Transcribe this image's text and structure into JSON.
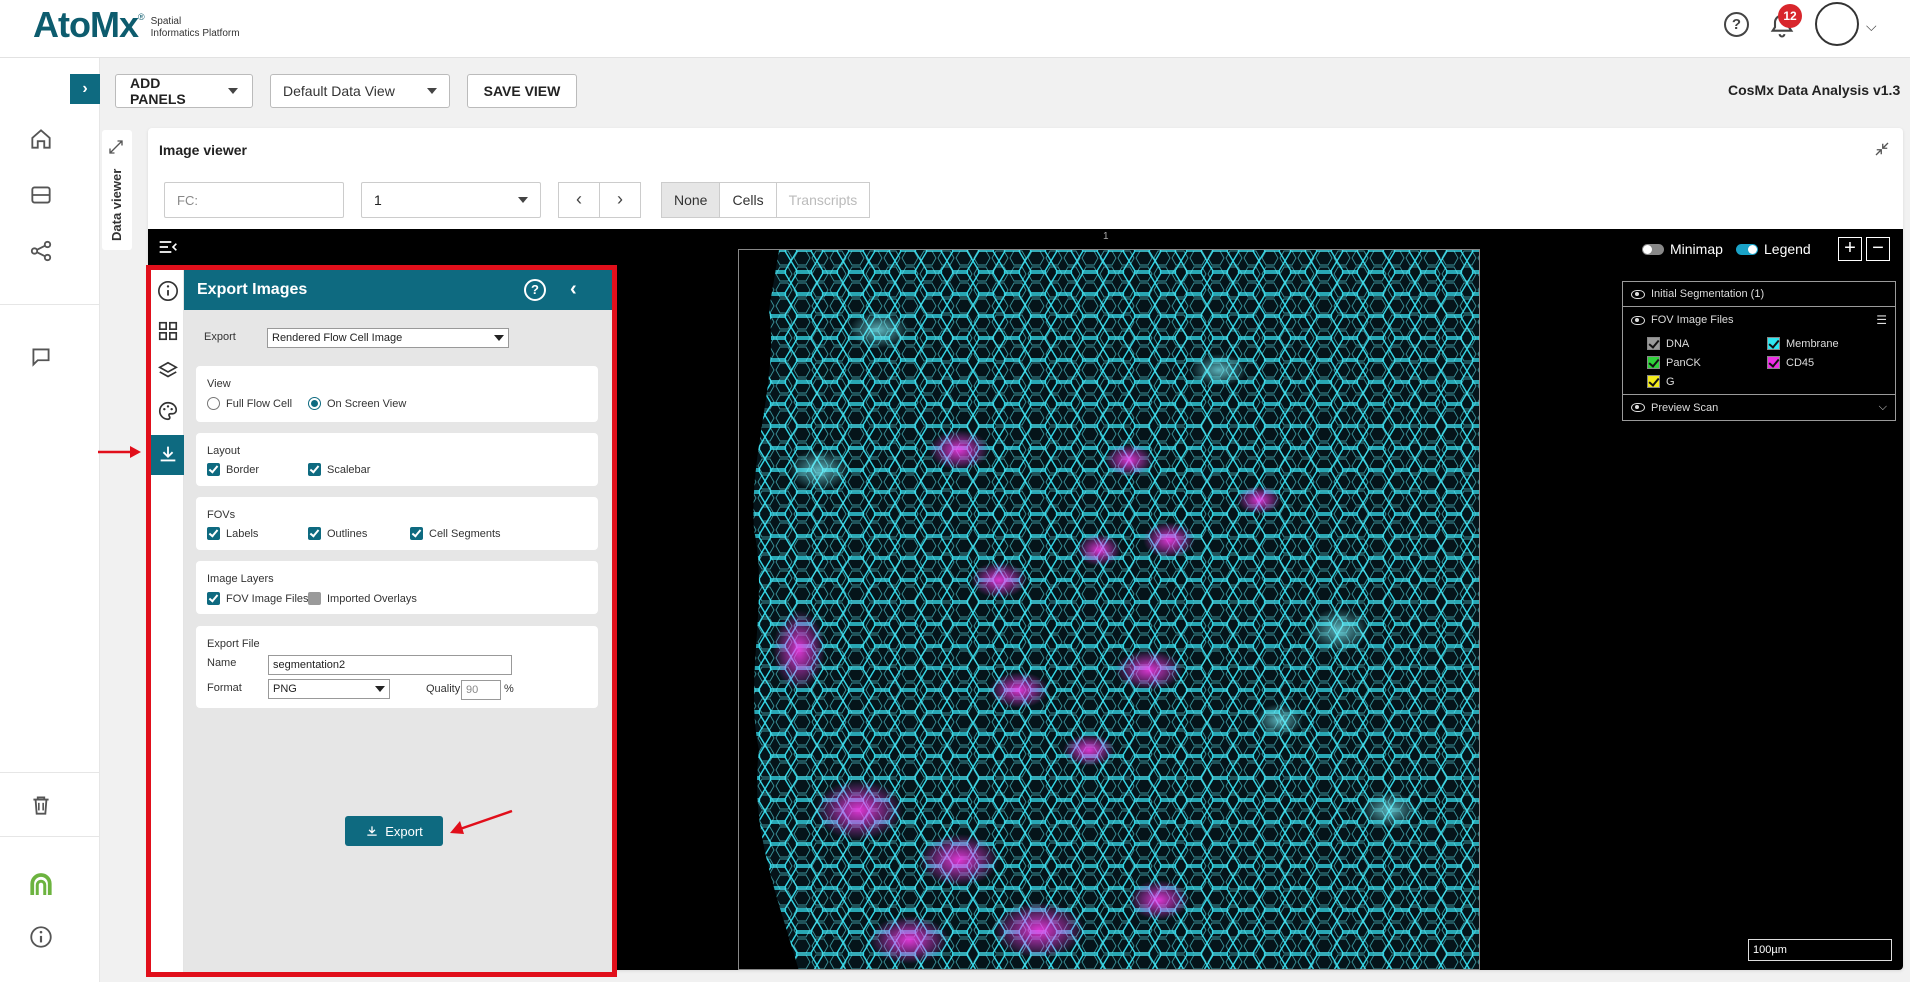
{
  "brand": {
    "name": "AtoMx",
    "trademark": "®",
    "subtitle_line1": "Spatial",
    "subtitle_line2": "Informatics Platform",
    "color": "#0d5c6e"
  },
  "header": {
    "notification_count": "12",
    "help_label": "?"
  },
  "toolbar": {
    "add_panels": "ADD PANELS",
    "data_view": "Default Data View",
    "save_view": "SAVE VIEW",
    "app_version": "CosMx Data Analysis v1.3"
  },
  "data_viewer_tab": "Data viewer",
  "image_viewer": {
    "title": "Image viewer",
    "fc_placeholder": "FC:",
    "fov_value": "1",
    "prev": "‹",
    "next": "›",
    "segments": [
      "None",
      "Cells",
      "Transcripts"
    ],
    "fov_label": "1"
  },
  "canvas_controls": {
    "minimap": "Minimap",
    "legend": "Legend",
    "zoom_in": "+",
    "zoom_out": "−"
  },
  "legend": {
    "initial_segmentation": "Initial Segmentation (1)",
    "fov_image_files": "FOV Image Files",
    "channels": [
      {
        "name": "DNA",
        "color": "#9a9a9a"
      },
      {
        "name": "Membrane",
        "color": "#2ee6f0"
      },
      {
        "name": "PanCK",
        "color": "#2fd13a"
      },
      {
        "name": "CD45",
        "color": "#ee2ee6"
      },
      {
        "name": "G",
        "color": "#f2ea1a"
      }
    ],
    "preview_scan": "Preview Scan"
  },
  "scalebar": "100µm",
  "export_panel": {
    "title": "Export Images",
    "help": "?",
    "close": "‹",
    "export_label": "Export",
    "export_value": "Rendered Flow Cell Image",
    "view": {
      "title": "View",
      "full_flow_cell": "Full Flow Cell",
      "on_screen_view": "On Screen View"
    },
    "layout": {
      "title": "Layout",
      "border": "Border",
      "scalebar": "Scalebar"
    },
    "fovs": {
      "title": "FOVs",
      "labels": "Labels",
      "outlines": "Outlines",
      "cell_segments": "Cell Segments"
    },
    "image_layers": {
      "title": "Image Layers",
      "fov_image_files": "FOV Image Files",
      "imported_overlays": "Imported Overlays"
    },
    "export_file": {
      "title": "Export File",
      "name_label": "Name",
      "name_value": "segmentation2",
      "format_label": "Format",
      "format_value": "PNG",
      "quality_label": "Quality",
      "quality_value": "90",
      "quality_unit": "%"
    },
    "export_button": "Export"
  },
  "colors": {
    "accent": "#0e6a80",
    "highlight_red": "#e10f1b"
  }
}
